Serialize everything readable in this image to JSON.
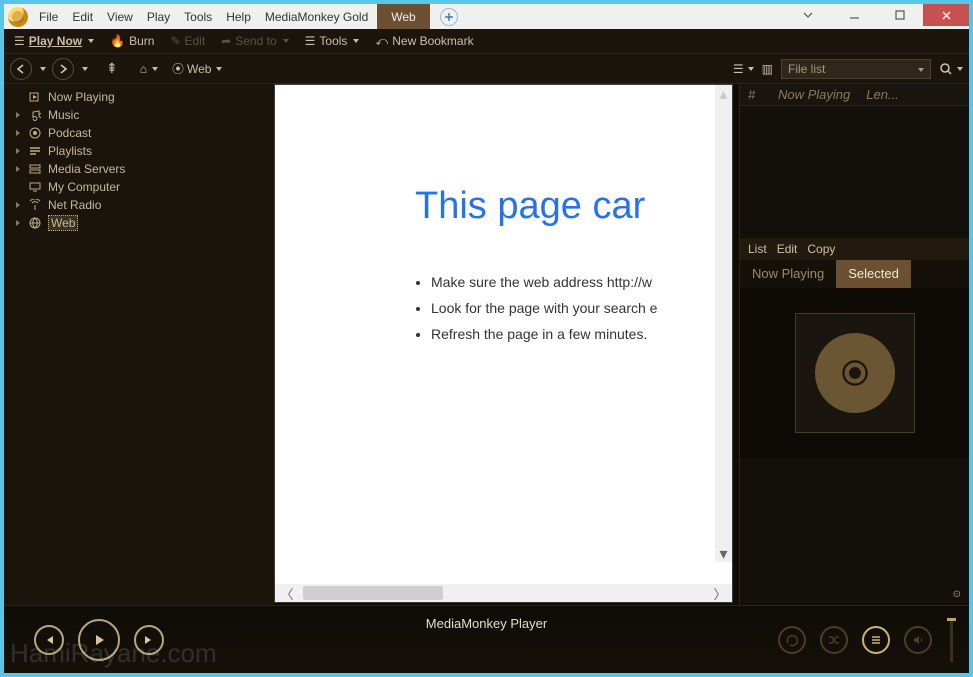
{
  "titlebar": {
    "menu": [
      "File",
      "Edit",
      "View",
      "Play",
      "Tools",
      "Help",
      "MediaMonkey Gold"
    ],
    "tab": "Web"
  },
  "toolbar": {
    "play_now": "Play Now",
    "burn": "Burn",
    "edit": "Edit",
    "send_to": "Send to",
    "tools": "Tools",
    "bookmark": "New Bookmark"
  },
  "navbar": {
    "crumb": "Web",
    "file_select": "File list"
  },
  "tree": [
    {
      "label": "Now Playing",
      "icon": "nowplaying",
      "expandable": false
    },
    {
      "label": "Music",
      "icon": "music",
      "expandable": true
    },
    {
      "label": "Podcast",
      "icon": "podcast",
      "expandable": true
    },
    {
      "label": "Playlists",
      "icon": "playlists",
      "expandable": true
    },
    {
      "label": "Media Servers",
      "icon": "servers",
      "expandable": true
    },
    {
      "label": "My Computer",
      "icon": "computer",
      "expandable": false
    },
    {
      "label": "Net Radio",
      "icon": "radio",
      "expandable": true
    },
    {
      "label": "Web",
      "icon": "web",
      "expandable": true,
      "selected": true
    }
  ],
  "web": {
    "heading": "This page car",
    "bullets": [
      "Make sure the web address http://w",
      "Look for the page with your search e",
      "Refresh the page in a few minutes."
    ]
  },
  "right": {
    "cols": [
      "#",
      "Now Playing",
      "Len..."
    ],
    "submenu": [
      "List",
      "Edit",
      "Copy"
    ],
    "tabs": {
      "now": "Now Playing",
      "selected": "Selected"
    }
  },
  "player": {
    "title": "MediaMonkey Player"
  },
  "watermark": "HamiRayane.com"
}
